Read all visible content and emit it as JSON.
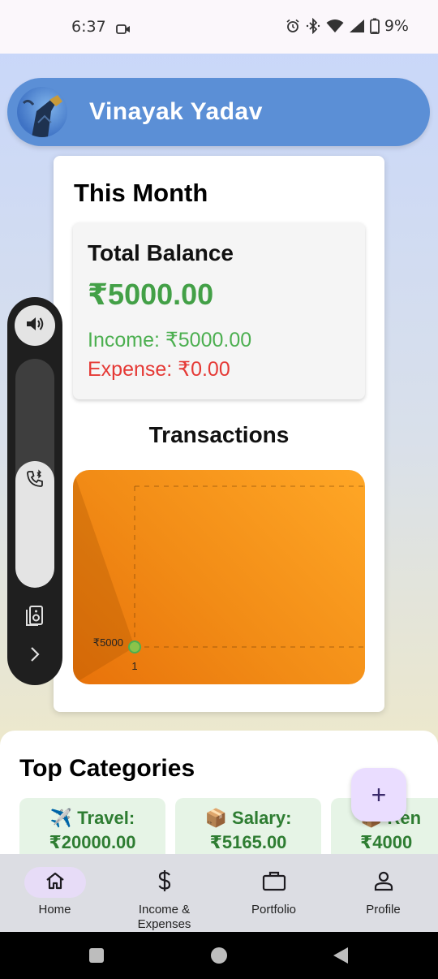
{
  "status_bar": {
    "time": "6:37",
    "battery": "9%"
  },
  "header": {
    "user_name": "Vinayak Yadav"
  },
  "month_card": {
    "title": "This Month",
    "balance_label": "Total Balance",
    "balance_value": "₹5000.00",
    "income": "Income: ₹5000.00",
    "expense": "Expense: ₹0.00",
    "transactions_title": "Transactions"
  },
  "chart_data": {
    "type": "line",
    "x": [
      1
    ],
    "series": [
      {
        "values": [
          5000
        ]
      }
    ],
    "x_tick_labels": [
      "1"
    ],
    "y_tick_labels": [
      "₹5000"
    ],
    "grid": true
  },
  "categories": {
    "title": "Top Categories",
    "items": [
      {
        "line1": "✈️ Travel:",
        "line2": "₹20000.00"
      },
      {
        "line1": "📦 Salary:",
        "line2": "₹5165.00"
      },
      {
        "line1": "📦 Ren",
        "line2": "₹4000"
      }
    ]
  },
  "fab": {
    "label": "+"
  },
  "nav": {
    "items": [
      {
        "label": "Home",
        "icon": "home-icon"
      },
      {
        "label": "Income & Expenses",
        "icon": "dollar-icon"
      },
      {
        "label": "Portfolio",
        "icon": "briefcase-icon"
      },
      {
        "label": "Profile",
        "icon": "person-icon"
      }
    ]
  },
  "colors": {
    "header": "#5b8fd6",
    "income": "#4caf50",
    "expense": "#e53935",
    "balance": "#43a047",
    "chart": "#f28c16"
  }
}
